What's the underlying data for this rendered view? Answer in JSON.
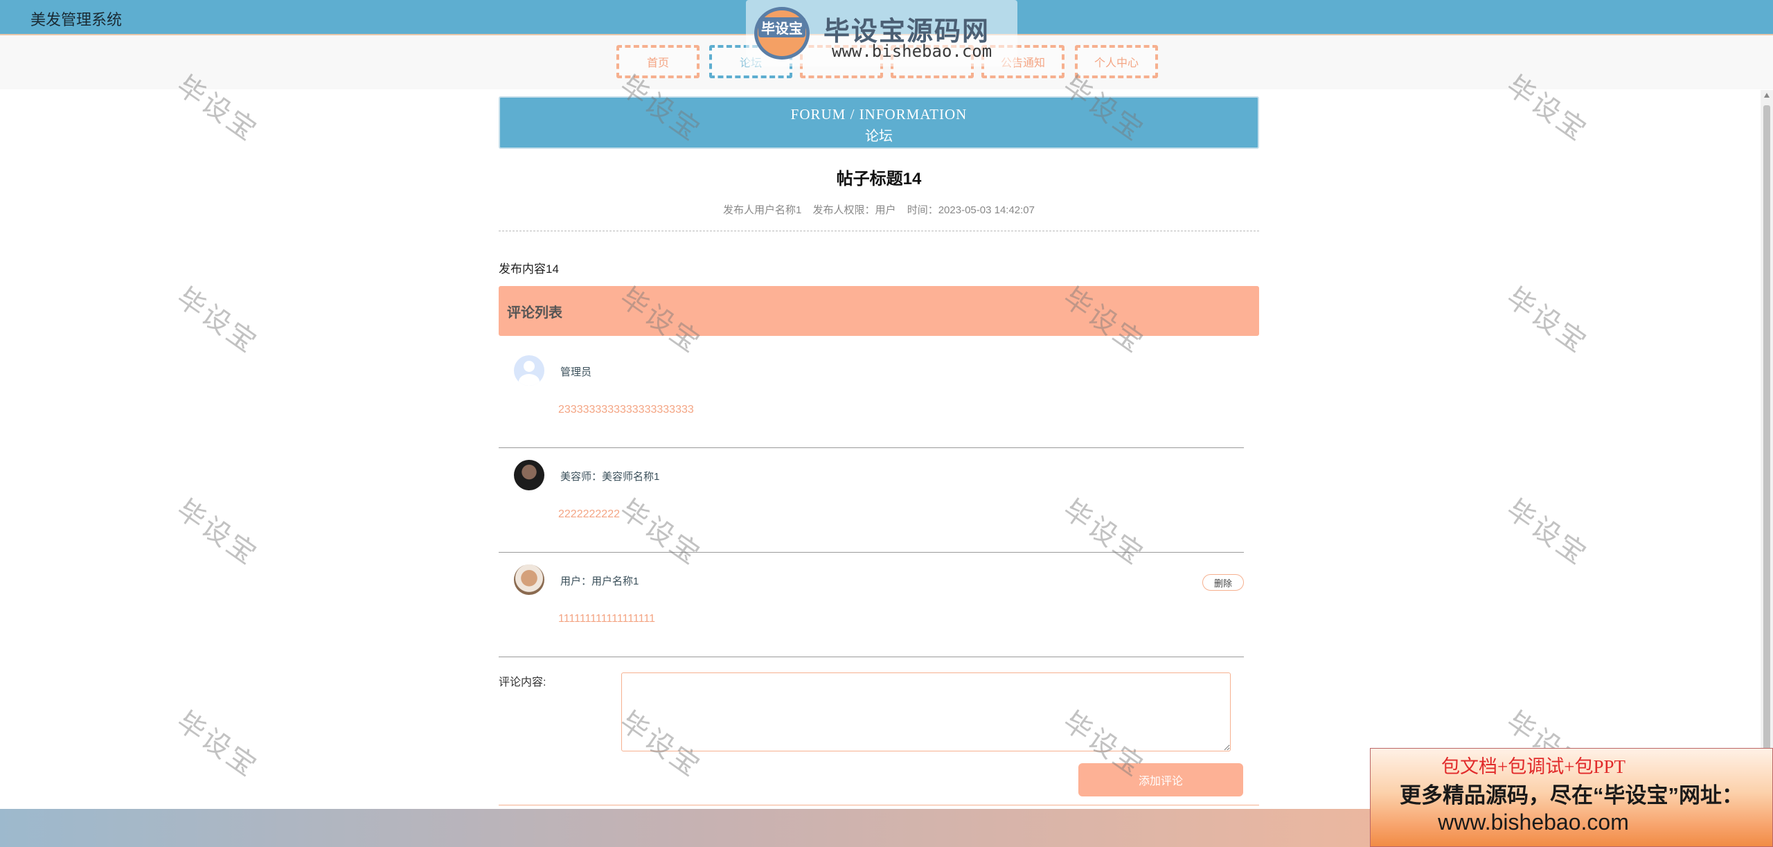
{
  "app": {
    "title": "美发管理系统"
  },
  "nav": {
    "items": [
      {
        "label": "首页",
        "active": false
      },
      {
        "label": "论坛",
        "active": true
      },
      {
        "label": "",
        "active": false
      },
      {
        "label": "",
        "active": false
      },
      {
        "label": "公告通知",
        "active": false
      },
      {
        "label": "个人中心",
        "active": false
      }
    ]
  },
  "logo": {
    "badge": "毕设宝",
    "name": "毕设宝源码网",
    "url": "www.bishebao.com"
  },
  "banner": {
    "en": "FORUM / INFORMATION",
    "cn": "论坛"
  },
  "post": {
    "title": "帖子标题14",
    "author": "发布人用户名称1",
    "role": "发布人权限：用户",
    "time": "时间：2023-05-03 14:42:07",
    "content": "发布内容14"
  },
  "comments": {
    "header": "评论列表",
    "items": [
      {
        "name": "管理员",
        "text": "2333333333333333333333",
        "avatar": "default-avatar-icon",
        "can_delete": false
      },
      {
        "name": "美容师：美容师名称1",
        "text": "2222222222",
        "avatar": "dark-photo-avatar",
        "can_delete": false
      },
      {
        "name": "用户：用户名称1",
        "text": "111111111111111111",
        "avatar": "light-photo-avatar",
        "can_delete": true
      }
    ],
    "delete_label": "删除"
  },
  "form": {
    "label": "评论内容:",
    "placeholder": "",
    "submit_label": "添加评论"
  },
  "watermark": {
    "text": "毕设宝"
  },
  "ad": {
    "line1": "包文档+包调试+包PPT",
    "line2": "更多精品源码，尽在“毕设宝”网址：",
    "line3": "www.bishebao.com"
  },
  "colors": {
    "primary": "#5eaed0",
    "accent": "#fdb195",
    "accent_text": "#f4a584"
  }
}
